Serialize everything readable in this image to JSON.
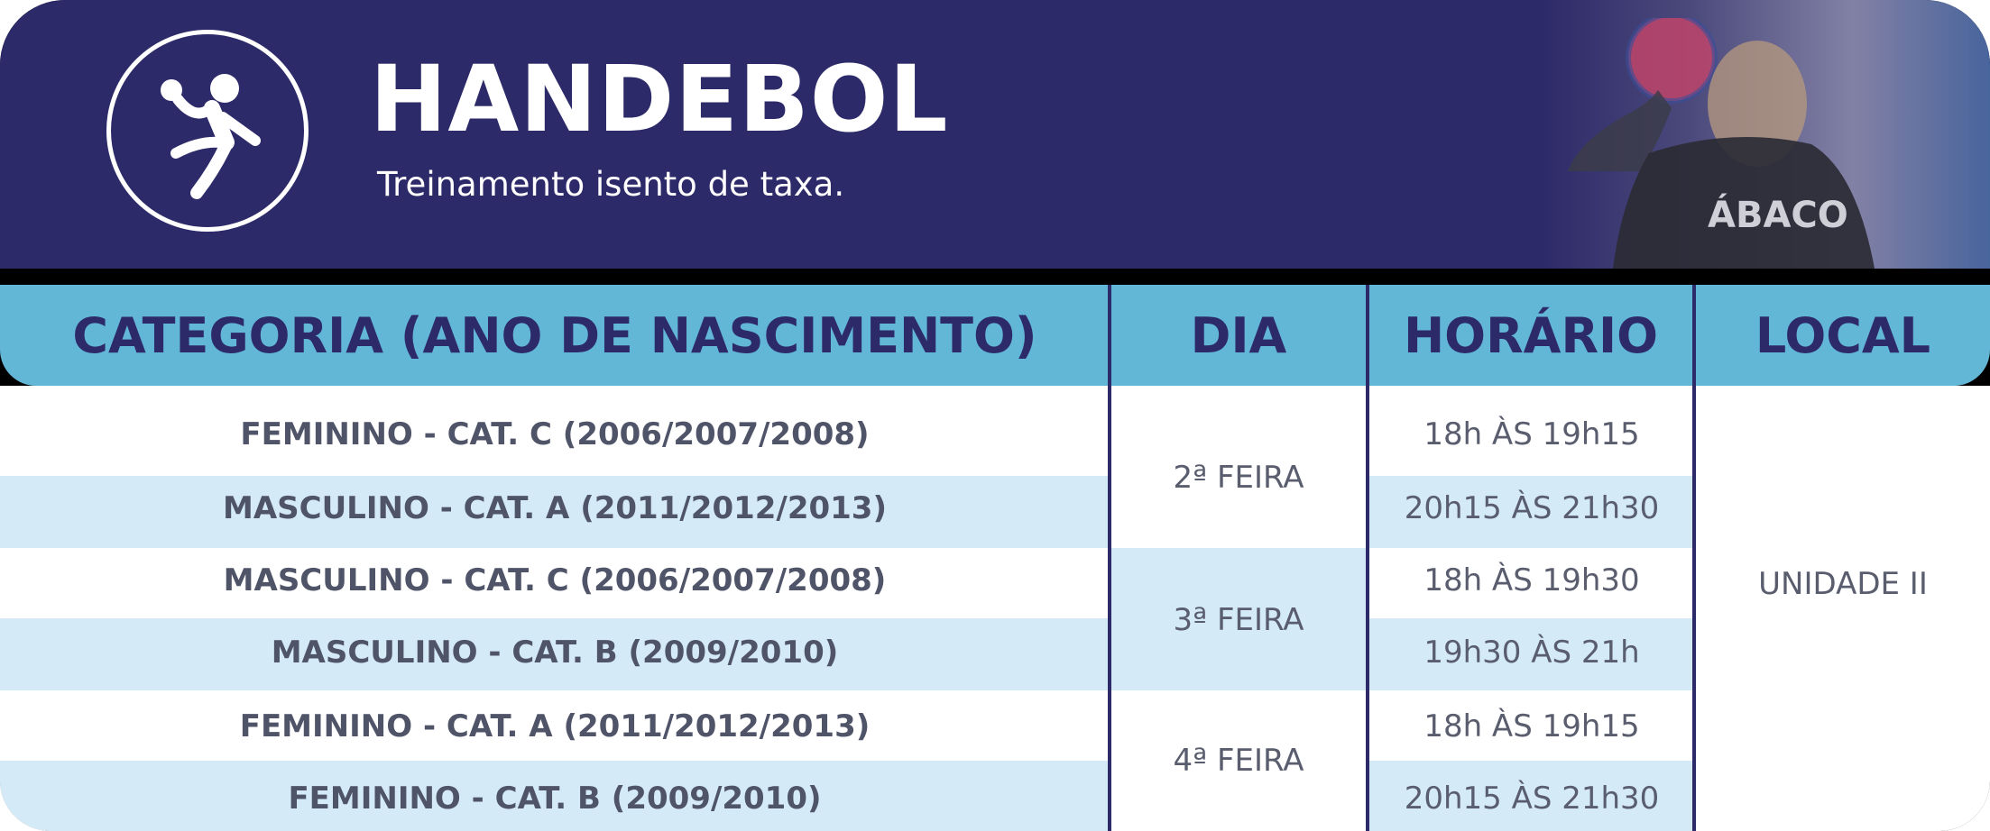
{
  "header": {
    "title": "HANDEBOL",
    "subtitle": "Treinamento isento de taxa.",
    "logo_icon": "handball-player-icon",
    "photo_text": "ÁBACO"
  },
  "table": {
    "columns": [
      "CATEGORIA (ANO DE NASCIMENTO)",
      "DIA",
      "HORÁRIO",
      "LOCAL"
    ],
    "rows": [
      {
        "categoria": "FEMININO - CAT. C (2006/2007/2008)",
        "horario": "18h ÀS 19h15"
      },
      {
        "categoria": "MASCULINO - CAT. A (2011/2012/2013)",
        "horario": "20h15 ÀS 21h30"
      },
      {
        "categoria": "MASCULINO - CAT. C (2006/2007/2008)",
        "horario": "18h ÀS 19h30"
      },
      {
        "categoria": "MASCULINO - CAT. B (2009/2010)",
        "horario": "19h30 ÀS 21h"
      },
      {
        "categoria": "FEMININO - CAT. A (2011/2012/2013)",
        "horario": "18h ÀS 19h15"
      },
      {
        "categoria": "FEMININO - CAT. B (2009/2010)",
        "horario": "20h15 ÀS 21h30"
      }
    ],
    "dias": [
      "2ª FEIRA",
      "3ª FEIRA",
      "4ª FEIRA"
    ],
    "local": "UNIDADE II"
  },
  "colors": {
    "header_bg": "#2d2a69",
    "table_header_bg": "#62b6d6",
    "row_alt_bg": "#d4ebf7"
  }
}
